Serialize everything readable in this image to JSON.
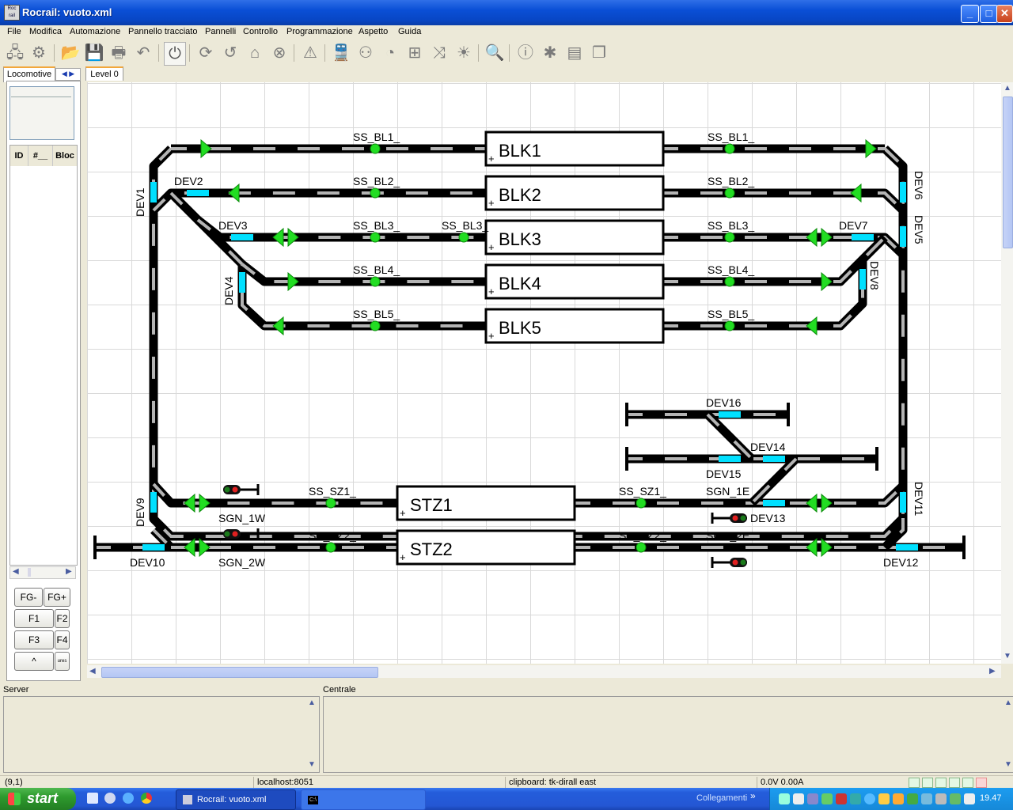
{
  "window": {
    "title": "Rocrail: vuoto.xml",
    "app_icon_text": "Roc rail",
    "minimize": "_",
    "maximize": "□",
    "close": "✕"
  },
  "menu": [
    "File",
    "Modifica",
    "Automazione",
    "Pannello tracciato",
    "Pannelli",
    "Controllo",
    "Programmazione",
    "Aspetto",
    "Guida"
  ],
  "left_panel": {
    "tab_label": "Locomotive",
    "tab_arrows": "◀ ▶",
    "columns": [
      "ID",
      "#__",
      "Bloc"
    ],
    "function_buttons": [
      "FG-",
      "FG+",
      "F1",
      "F2",
      "F3",
      "F4",
      "^",
      "ures"
    ]
  },
  "plan": {
    "level_tab": "Level 0",
    "blocks": [
      "BLK1",
      "BLK2",
      "BLK3",
      "BLK4",
      "BLK5",
      "STZ1",
      "STZ2"
    ],
    "block_plus": "+",
    "sensors_left": [
      "SS_BL1_",
      "SS_BL2_",
      "SS_BL3_",
      "SS_BL3_",
      "SS_BL4_",
      "SS_BL5_",
      "SS_SZ1_",
      "SS_SZ2_"
    ],
    "sensors_right": [
      "SS_BL1_",
      "SS_BL2_",
      "SS_BL3_",
      "SS_BL4_",
      "SS_BL5_",
      "SS_SZ1_",
      "SS_SZ2_"
    ],
    "switches": [
      "DEV1",
      "DEV2",
      "DEV3",
      "DEV4",
      "DEV5",
      "DEV6",
      "DEV7",
      "DEV8",
      "DEV9",
      "DEV10",
      "DEV11",
      "DEV12",
      "DEV13",
      "DEV14",
      "DEV15",
      "DEV16"
    ],
    "signals": [
      "SGN_1W",
      "SGN_2W",
      "SGN_1E",
      "SGN_2E"
    ]
  },
  "bottom": {
    "server_label": "Server",
    "centrale_label": "Centrale"
  },
  "status": {
    "coords": "(9,1)",
    "host": "localhost:8051",
    "clipboard": "clipboard: tk-dirall east",
    "power": "0.0V 0.00A"
  },
  "taskbar": {
    "start": "start",
    "task_rocrail": "Rocrail: vuoto.xml",
    "task_cmd": "C:\\",
    "links": "Collegamenti",
    "links_chevron": "»",
    "clock": "19.47"
  },
  "colors": {
    "track": "#000000",
    "track_dash": "#b4b4b4",
    "sensor": "#22dd22",
    "switch_mark": "#00e0ff",
    "signal_arrow": "#22dd22",
    "grid": "#d9d9d9"
  }
}
